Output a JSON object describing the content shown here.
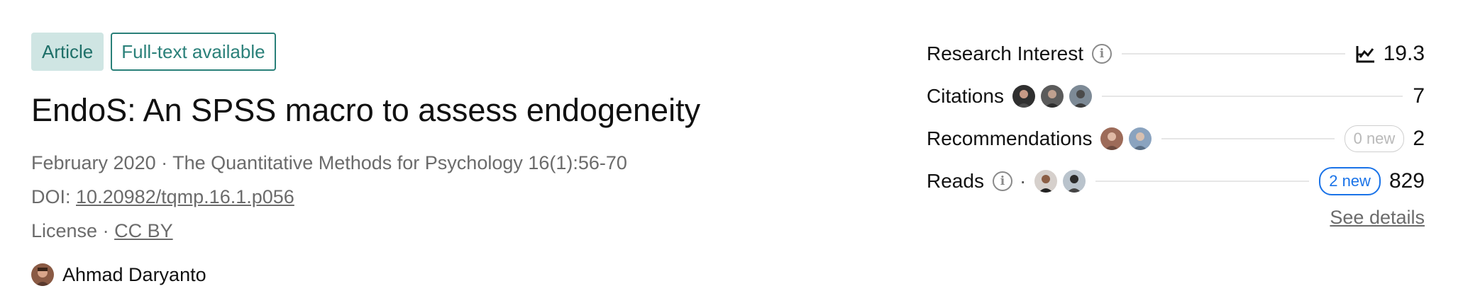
{
  "badges": {
    "type": "Article",
    "fulltext": "Full-text available"
  },
  "publication": {
    "title": "EndoS: An SPSS macro to assess endogeneity",
    "date_journal": "February 2020 · The Quantitative Methods for Psychology 16(1):56-70",
    "doi_label": "DOI:",
    "doi": "10.20982/tqmp.16.1.p056",
    "license_label": "License ·",
    "license": "CC BY"
  },
  "author": {
    "name": "Ahmad Daryanto"
  },
  "stats": {
    "research_interest": {
      "label": "Research Interest",
      "value": "19.3"
    },
    "citations": {
      "label": "Citations",
      "value": "7"
    },
    "recommendations": {
      "label": "Recommendations",
      "new_label": "0 new",
      "value": "2"
    },
    "reads": {
      "label": "Reads",
      "separator": "·",
      "new_label": "2 new",
      "value": "829"
    },
    "see_details": "See details"
  },
  "colors": {
    "teal_accent": "#2a8079",
    "teal_bg": "#cfe5e3",
    "blue_accent": "#1a73e8",
    "muted_text": "#6b6b6b"
  },
  "icons": {
    "info": "info-icon",
    "trend": "research-interest-icon"
  }
}
